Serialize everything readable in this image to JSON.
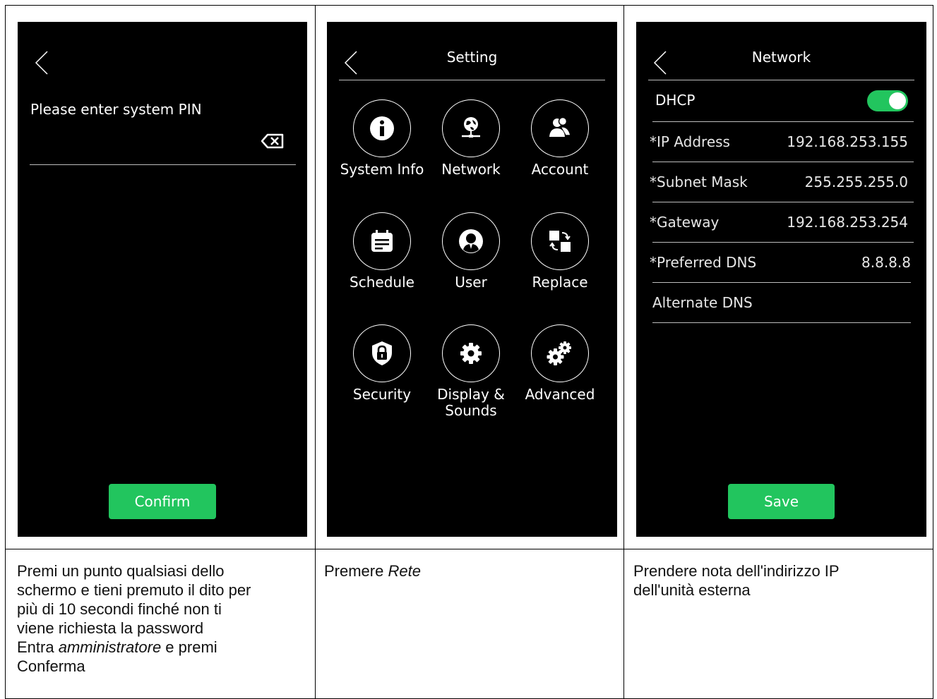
{
  "panel1": {
    "prompt": "Please enter system PIN",
    "confirm_label": "Confirm"
  },
  "panel2": {
    "title": "Setting",
    "tiles": [
      {
        "label": "System Info",
        "icon": "info-icon"
      },
      {
        "label": "Network",
        "icon": "network-globe-icon"
      },
      {
        "label": "Account",
        "icon": "account-users-icon"
      },
      {
        "label": "Schedule",
        "icon": "calendar-icon"
      },
      {
        "label": "User",
        "icon": "user-icon"
      },
      {
        "label": "Replace",
        "icon": "replace-icon"
      },
      {
        "label": "Security",
        "icon": "shield-lock-icon"
      },
      {
        "label": "Display &\nSounds",
        "icon": "gear-icon"
      },
      {
        "label": "Advanced",
        "icon": "gears-icon"
      }
    ]
  },
  "panel3": {
    "title": "Network",
    "dhcp_label": "DHCP",
    "dhcp_on": true,
    "fields": [
      {
        "label": "*IP Address",
        "value": "192.168.253.155"
      },
      {
        "label": "*Subnet Mask",
        "value": "255.255.255.0"
      },
      {
        "label": "*Gateway",
        "value": "192.168.253.254"
      },
      {
        "label": "*Preferred DNS",
        "value": "8.8.8.8"
      },
      {
        "label": "Alternate DNS",
        "value": ""
      }
    ],
    "save_label": "Save"
  },
  "captions": {
    "c1_line1": "Premi un punto qualsiasi dello",
    "c1_line2": "schermo e tieni premuto il dito per",
    "c1_line3": "più di 10 secondi finché non ti",
    "c1_line4": "viene richiesta la password",
    "c1_line5_pre": "Entra ",
    "c1_line5_em": "amministratore",
    "c1_line5_post": " e premi",
    "c1_line6": "Conferma",
    "c2_pre": "Premere ",
    "c2_em": "Rete",
    "c3_line1": "Prendere nota dell'indirizzo IP",
    "c3_line2": "dell'unità esterna"
  },
  "colors": {
    "accent": "#22c55e",
    "screen_bg": "#000000"
  }
}
